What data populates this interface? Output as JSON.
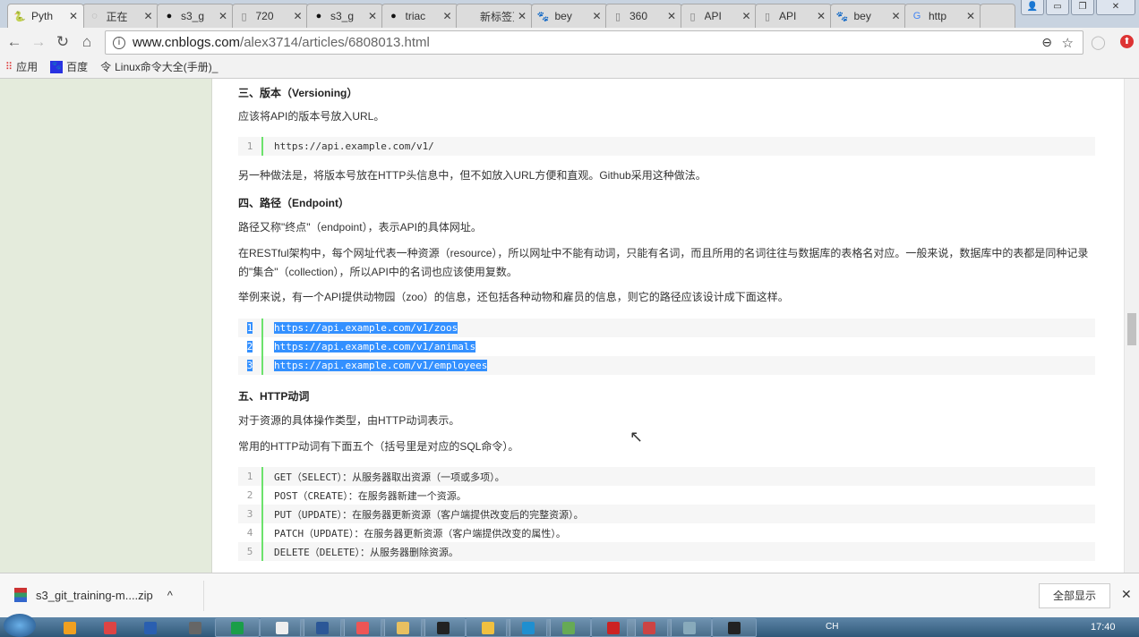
{
  "browser": {
    "tabs": [
      {
        "title": "Pyth",
        "icon": "python-icon",
        "active": true
      },
      {
        "title": "正在",
        "icon": "loading-icon"
      },
      {
        "title": "s3_g",
        "icon": "github-icon"
      },
      {
        "title": "720",
        "icon": "document-icon"
      },
      {
        "title": "s3_g",
        "icon": "github-icon"
      },
      {
        "title": "triac",
        "icon": "github-icon"
      },
      {
        "title": "新标签页",
        "icon": "none"
      },
      {
        "title": "bey",
        "icon": "baidu-icon"
      },
      {
        "title": "360",
        "icon": "document-icon"
      },
      {
        "title": "API",
        "icon": "document-icon"
      },
      {
        "title": "API",
        "icon": "document-icon"
      },
      {
        "title": "bey",
        "icon": "baidu-icon"
      },
      {
        "title": "http",
        "icon": "google-icon"
      }
    ],
    "url_host": "www.cnblogs.com",
    "url_path": "/alex3714/articles/6808013.html",
    "bookmarks": [
      {
        "label": "应用",
        "icon": "apps-icon"
      },
      {
        "label": "百度",
        "icon": "baidu-icon"
      },
      {
        "label": "Linux命令大全(手册)_",
        "icon": "linux-icon"
      }
    ]
  },
  "article": {
    "h3": "三、版本（Versioning）",
    "p1": "应该将API的版本号放入URL。",
    "code1": [
      {
        "n": "1",
        "t": "https://api.example.com/v1/"
      }
    ],
    "p2": "另一种做法是，将版本号放在HTTP头信息中，但不如放入URL方便和直观。Github采用这种做法。",
    "h4": "四、路径（Endpoint）",
    "p3": "路径又称\"终点\"（endpoint），表示API的具体网址。",
    "p4": "在RESTful架构中，每个网址代表一种资源（resource），所以网址中不能有动词，只能有名词，而且所用的名词往往与数据库的表格名对应。一般来说，数据库中的表都是同种记录的\"集合\"（collection），所以API中的名词也应该使用复数。",
    "p5": "举例来说，有一个API提供动物园（zoo）的信息，还包括各种动物和雇员的信息，则它的路径应该设计成下面这样。",
    "code2": [
      {
        "n": "1",
        "t": "https://api.example.com/v1/zoos"
      },
      {
        "n": "2",
        "t": "https://api.example.com/v1/animals"
      },
      {
        "n": "3",
        "t": "https://api.example.com/v1/employees"
      }
    ],
    "h5": "五、HTTP动词",
    "p6": "对于资源的具体操作类型，由HTTP动词表示。",
    "p7": "常用的HTTP动词有下面五个（括号里是对应的SQL命令）。",
    "code3": [
      {
        "n": "1",
        "t": "GET（SELECT）：从服务器取出资源（一项或多项）。"
      },
      {
        "n": "2",
        "t": "POST（CREATE）：在服务器新建一个资源。"
      },
      {
        "n": "3",
        "t": "PUT（UPDATE）：在服务器更新资源（客户端提供改变后的完整资源）。"
      },
      {
        "n": "4",
        "t": "PATCH（UPDATE）：在服务器更新资源（客户端提供改变的属性）。"
      },
      {
        "n": "5",
        "t": "DELETE（DELETE）：从服务器删除资源。"
      }
    ]
  },
  "download": {
    "file": "s3_git_training-m....zip",
    "show_all": "全部显示"
  },
  "taskbar": {
    "ime": "CH",
    "clock": "17:40"
  }
}
